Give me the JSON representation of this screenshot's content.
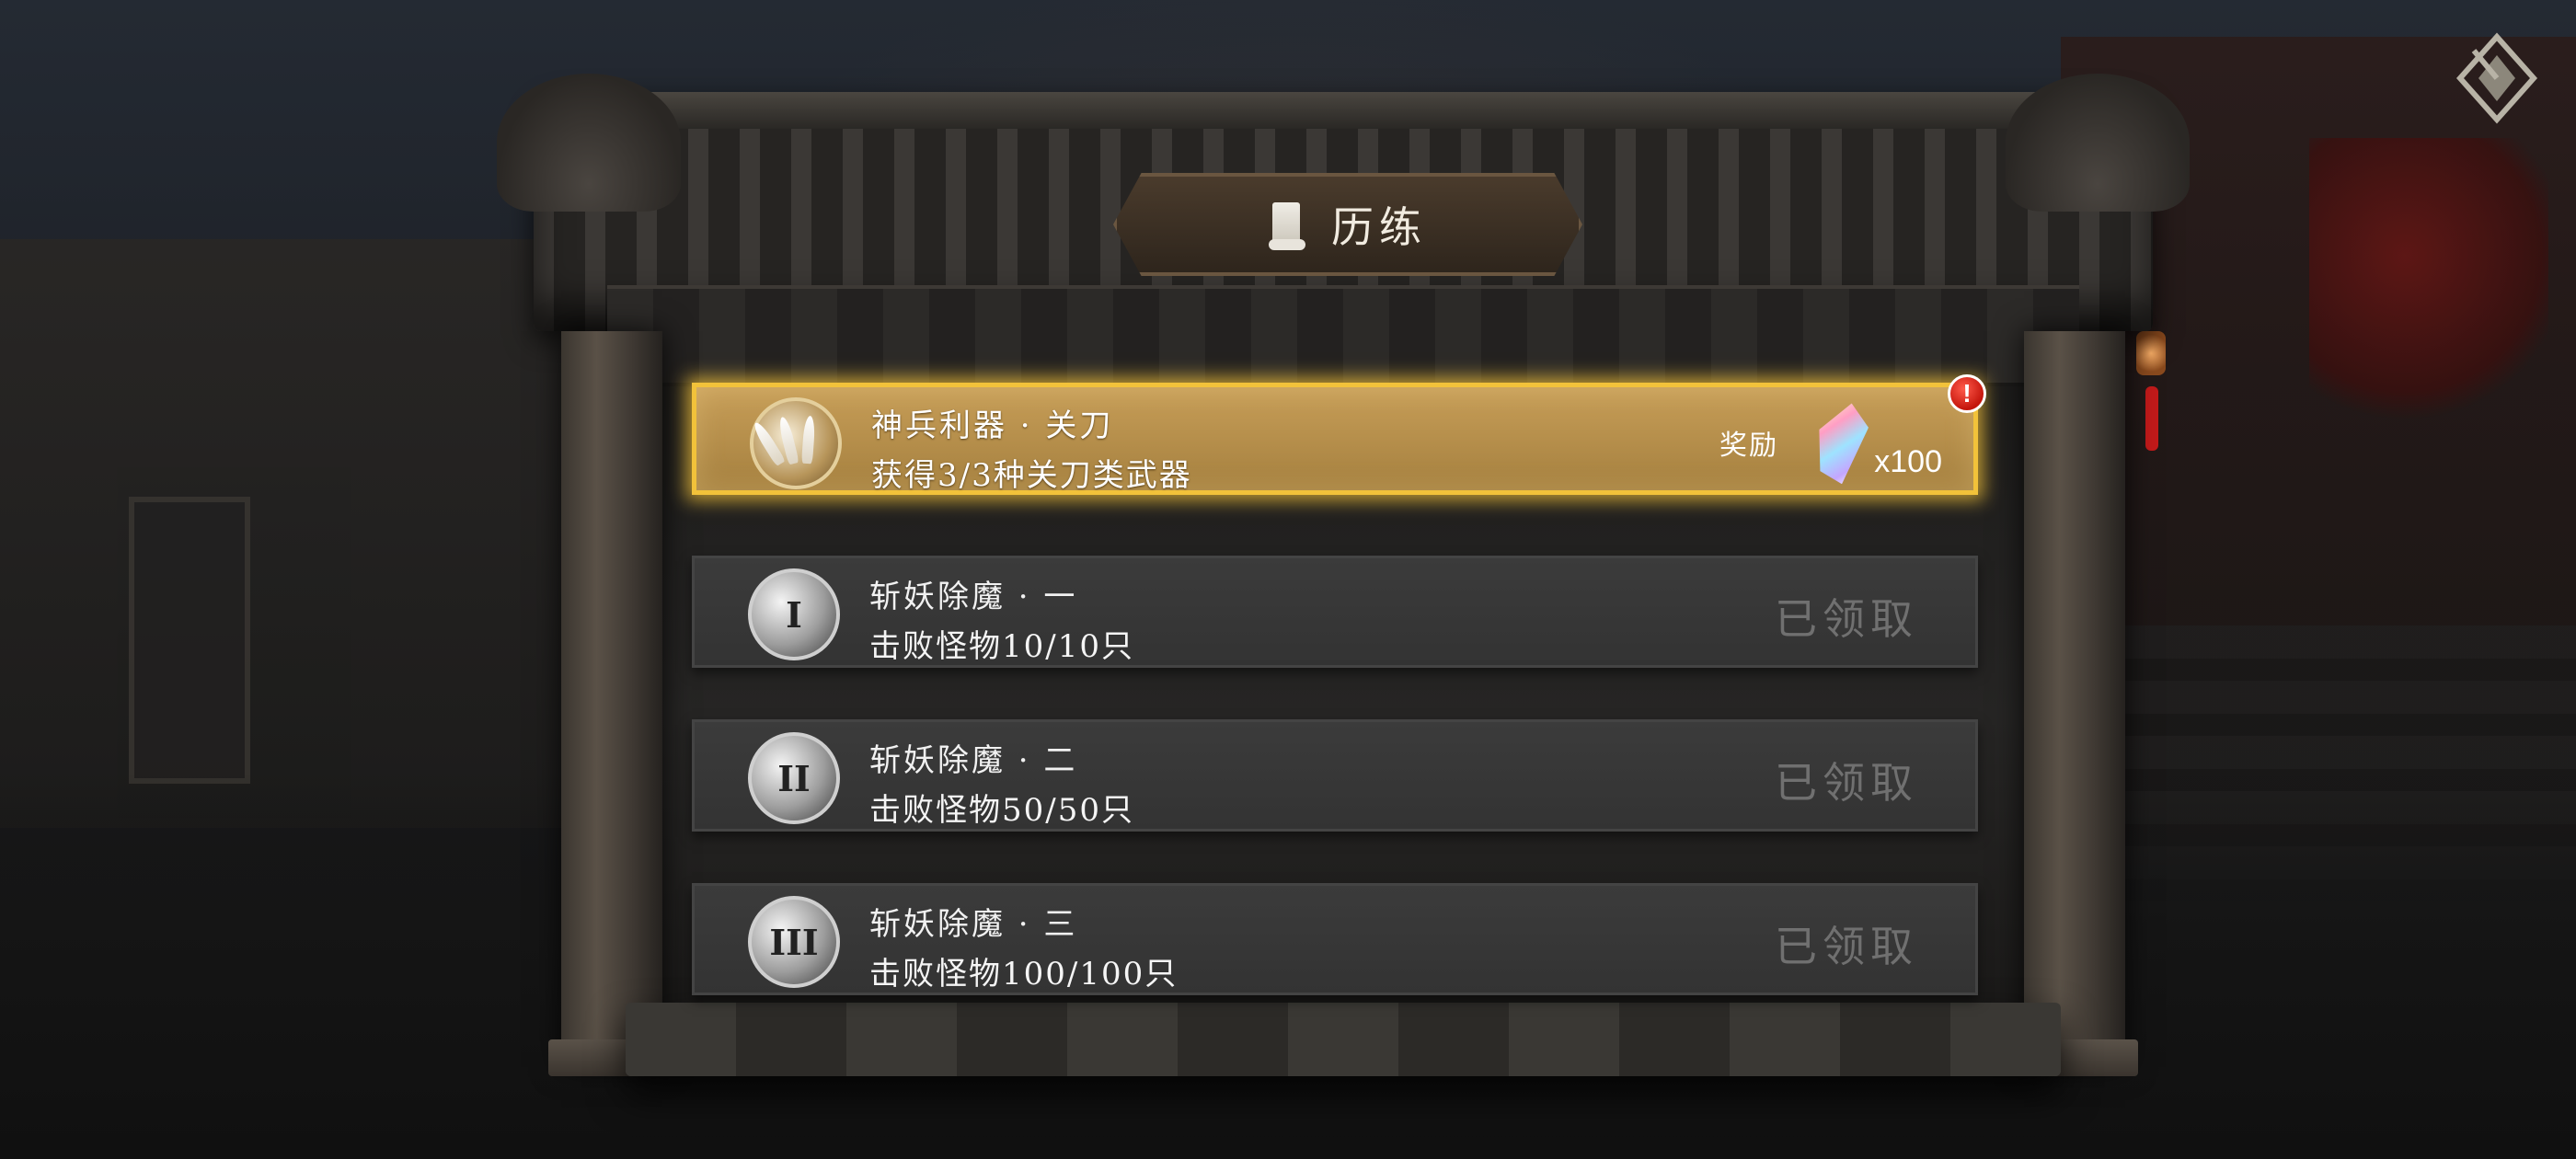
{
  "title": {
    "text": "历练",
    "icon": "scroll-icon"
  },
  "tasks": [
    {
      "name": "神兵利器 · 关刀",
      "desc": "获得3/3种关刀类武器",
      "icon": "claw-icon",
      "status": "active",
      "reward_label": "奖励",
      "reward_icon": "gem-icon",
      "reward_count": "x100",
      "alert": "!"
    },
    {
      "name": "斩妖除魔 · 一",
      "desc": "击败怪物10/10只",
      "icon": "tier-1-icon",
      "icon_glyph": "I",
      "status_text": "已领取"
    },
    {
      "name": "斩妖除魔 · 二",
      "desc": "击败怪物50/50只",
      "icon": "tier-2-icon",
      "icon_glyph": "II",
      "status_text": "已领取"
    },
    {
      "name": "斩妖除魔 · 三",
      "desc": "击败怪物100/100只",
      "icon": "tier-3-icon",
      "icon_glyph": "III",
      "status_text": "已领取"
    }
  ],
  "colors": {
    "active_border": "#f2c23a",
    "active_bg": "#c79e58",
    "claimed_text": "#707070",
    "alert": "#c4150c"
  },
  "back_button_icon": "back-icon"
}
